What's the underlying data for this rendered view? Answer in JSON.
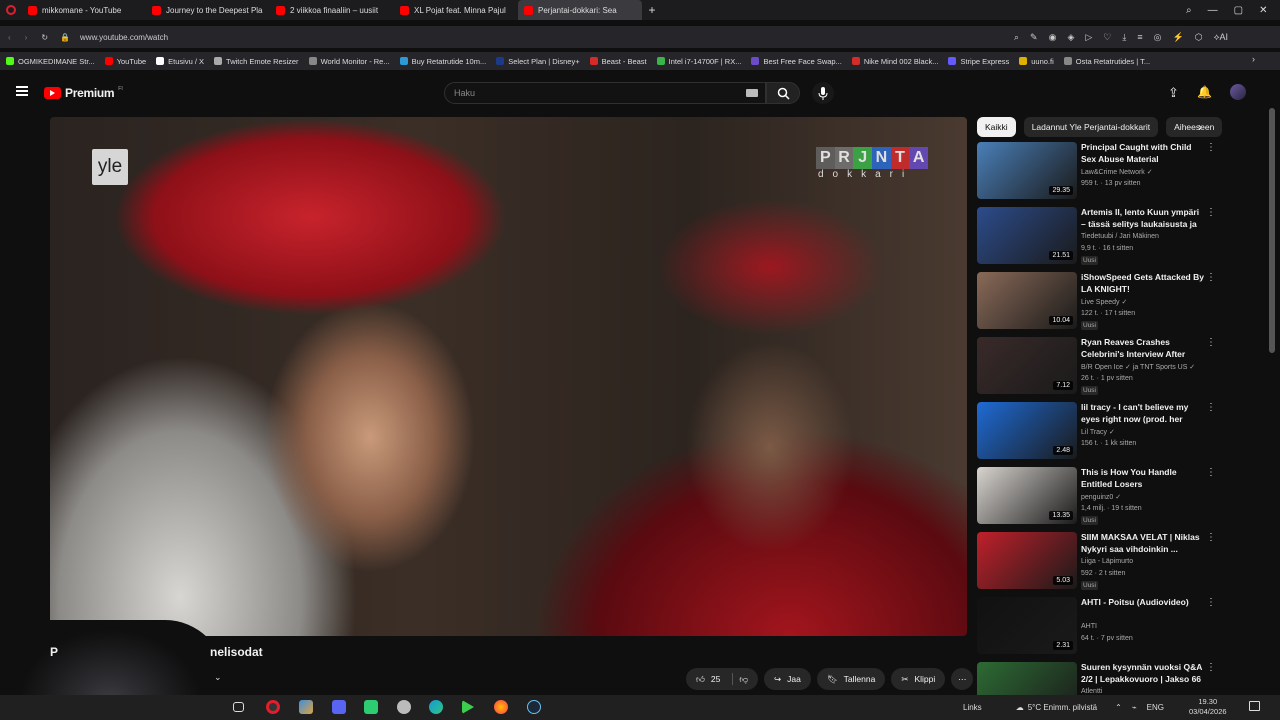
{
  "browser": {
    "tabs": [
      {
        "title": "mikkomane - YouTube",
        "color": "#ff0000"
      },
      {
        "title": "Journey to the Deepest Pla",
        "color": "#ff0000"
      },
      {
        "title": "2 viikkoa finaaliin – uusiit",
        "color": "#ff0000"
      },
      {
        "title": "XL Pojat feat. Minna Pajul",
        "color": "#ff0000"
      },
      {
        "title": "Perjantai-dokkari: Sea",
        "color": "#ff0000",
        "active": true
      }
    ],
    "url": "www.youtube.com/watch",
    "bookmarks": [
      {
        "label": "OGMIKEDIMANE Str...",
        "color": "#53fc18"
      },
      {
        "label": "YouTube",
        "color": "#ff0000"
      },
      {
        "label": "Etusivu / X",
        "color": "#ffffff"
      },
      {
        "label": "Twitch Emote Resizer",
        "color": "#aaaaaa"
      },
      {
        "label": "World Monitor - Re...",
        "color": "#888888"
      },
      {
        "label": "Buy Retatrutide 10m...",
        "color": "#2b9ad6"
      },
      {
        "label": "Select Plan | Disney+",
        "color": "#1b3b8a"
      },
      {
        "label": "Beast - Beast",
        "color": "#d62b2b"
      },
      {
        "label": "Intel i7-14700F | RX...",
        "color": "#3bb54a"
      },
      {
        "label": "Best Free Face Swap...",
        "color": "#6a4cc9"
      },
      {
        "label": "Nike Mind 002 Black...",
        "color": "#d62b2b"
      },
      {
        "label": "Stripe Express",
        "color": "#635bff"
      },
      {
        "label": "uuno.fi",
        "color": "#e0b000"
      },
      {
        "label": "Osta Retatrutides | T...",
        "color": "#888888"
      }
    ]
  },
  "header": {
    "brand": "Premium",
    "brand_sup": "FI",
    "search_placeholder": "Haku"
  },
  "video": {
    "overlay_left": "yle",
    "overlay_right_sub": "dokkari",
    "overlay_right_letters": [
      "P",
      "R",
      "J",
      "N",
      "T",
      "A"
    ],
    "title_start": "P",
    "title_end": "nelisodat"
  },
  "actions": {
    "likes": "25",
    "share": "Jaa",
    "save": "Tallenna",
    "clip": "Klippi"
  },
  "chips": [
    "Kaikki",
    "Ladannut Yle Perjantai-dokkarit",
    "Aiheeseen"
  ],
  "recommendations": [
    {
      "title": "Principal Caught with Child Sex Abuse Material",
      "channel": "Law&Crime Network ✓",
      "meta": "959 t. · 13 pv sitten",
      "duration": "29.35",
      "thumb": "#4a7fb8",
      "new": false
    },
    {
      "title": "Artemis II, lento Kuun ympäri – tässä selitys laukaisusta ja ...",
      "channel": "Tiedetuubi / Jari Mäkinen",
      "meta": "9,9 t. · 16 t sitten",
      "duration": "21.51",
      "thumb": "#2c4c8c",
      "new": true
    },
    {
      "title": "iShowSpeed Gets Attacked By LA KNIGHT!",
      "channel": "Live Speedy ✓",
      "meta": "122 t. · 17 t sitten",
      "duration": "10.04",
      "thumb": "#8a6a58",
      "new": true
    },
    {
      "title": "Ryan Reaves Crashes Celebrini's Interview After His...",
      "channel": "B/R Open Ice ✓ ja TNT Sports US ✓",
      "meta": "26 t. · 1 pv sitten",
      "duration": "7.12",
      "thumb": "#3a2a2a",
      "new": true
    },
    {
      "title": "lil tracy - I can't believe my eyes right now (prod. her blood 🩸)",
      "channel": "Lil Tracy ✓",
      "meta": "156 t. · 1 kk sitten",
      "duration": "2.48",
      "thumb": "#1e6bd6",
      "new": false
    },
    {
      "title": "This is How You Handle Entitled Losers",
      "channel": "penguinz0 ✓",
      "meta": "1,4 milj. · 19 t sitten",
      "duration": "13.35",
      "thumb": "#d8d4cf",
      "new": true
    },
    {
      "title": "SIIM MAKSAA VELAT | Niklas Nykyri saa vihdoinkin ...",
      "channel": "Liiga - Läpimurto",
      "meta": "592 · 2 t sitten",
      "duration": "5.03",
      "thumb": "#c0202a",
      "new": true
    },
    {
      "title": "AHTI - Poitsu (Audiovideo)",
      "channel": "AHTI",
      "meta": "64 t. · 7 pv sitten",
      "duration": "2.31",
      "thumb": "#111111",
      "new": false
    },
    {
      "title": "Suuren kysynnän vuoksi Q&A 2/2 | Lepakkovuoro | Jakso 66",
      "channel": "Atlentti",
      "meta": "",
      "duration": "",
      "thumb": "#2d6b34",
      "new": false
    }
  ],
  "taskbar": {
    "links": "Links",
    "weather": "5°C  Enimm. pilvistä",
    "lang": "ENG",
    "time": "19.30",
    "date": "03/04/2026"
  }
}
